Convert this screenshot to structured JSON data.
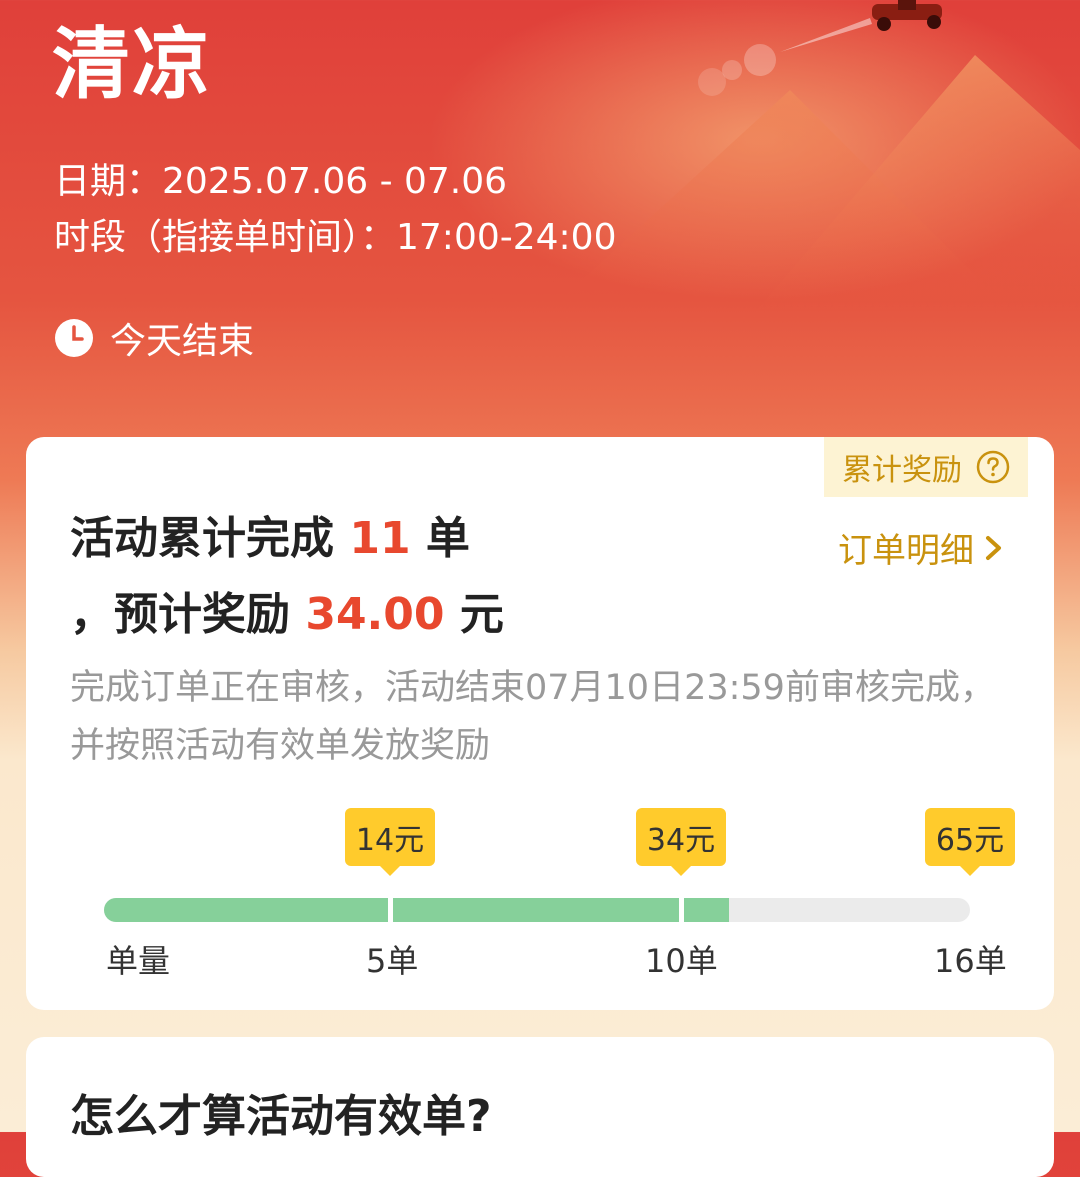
{
  "header": {
    "title": "清凉",
    "date_line": "日期：2025.07.06 - 07.06",
    "period_line": "时段（指接单时间）：17:00-24:00",
    "end_status": "今天结束"
  },
  "progress_card": {
    "cumulative_badge": "累计奖励",
    "line1_prefix": "活动累计完成",
    "completed_count": "11",
    "line1_suffix": "单",
    "line2_prefix": "，预计奖励",
    "reward_amount": "34.00",
    "line2_suffix": "元",
    "detail_link": "订单明细",
    "note": "完成订单正在审核，活动结束07月10日23:59前审核完成，并按照活动有效单发放奖励",
    "progress": {
      "completed_orders": 11,
      "max_orders": 16,
      "axis_label": "单量",
      "milestones": [
        {
          "orders": 5,
          "label": "5单",
          "reward": "14元"
        },
        {
          "orders": 10,
          "label": "10单",
          "reward": "34元"
        },
        {
          "orders": 16,
          "label": "16单",
          "reward": "65元"
        }
      ]
    }
  },
  "faq_card": {
    "title": "怎么才算活动有效单?"
  },
  "colors": {
    "brand_red": "#e0403a",
    "highlight_red": "#e8482e",
    "gold": "#c9920e",
    "tag_yellow": "#ffcb2c",
    "progress_green": "#86d09a"
  },
  "icons": [
    "clock-icon",
    "question-icon",
    "chevron-right-icon",
    "scooter-rider-icon"
  ]
}
